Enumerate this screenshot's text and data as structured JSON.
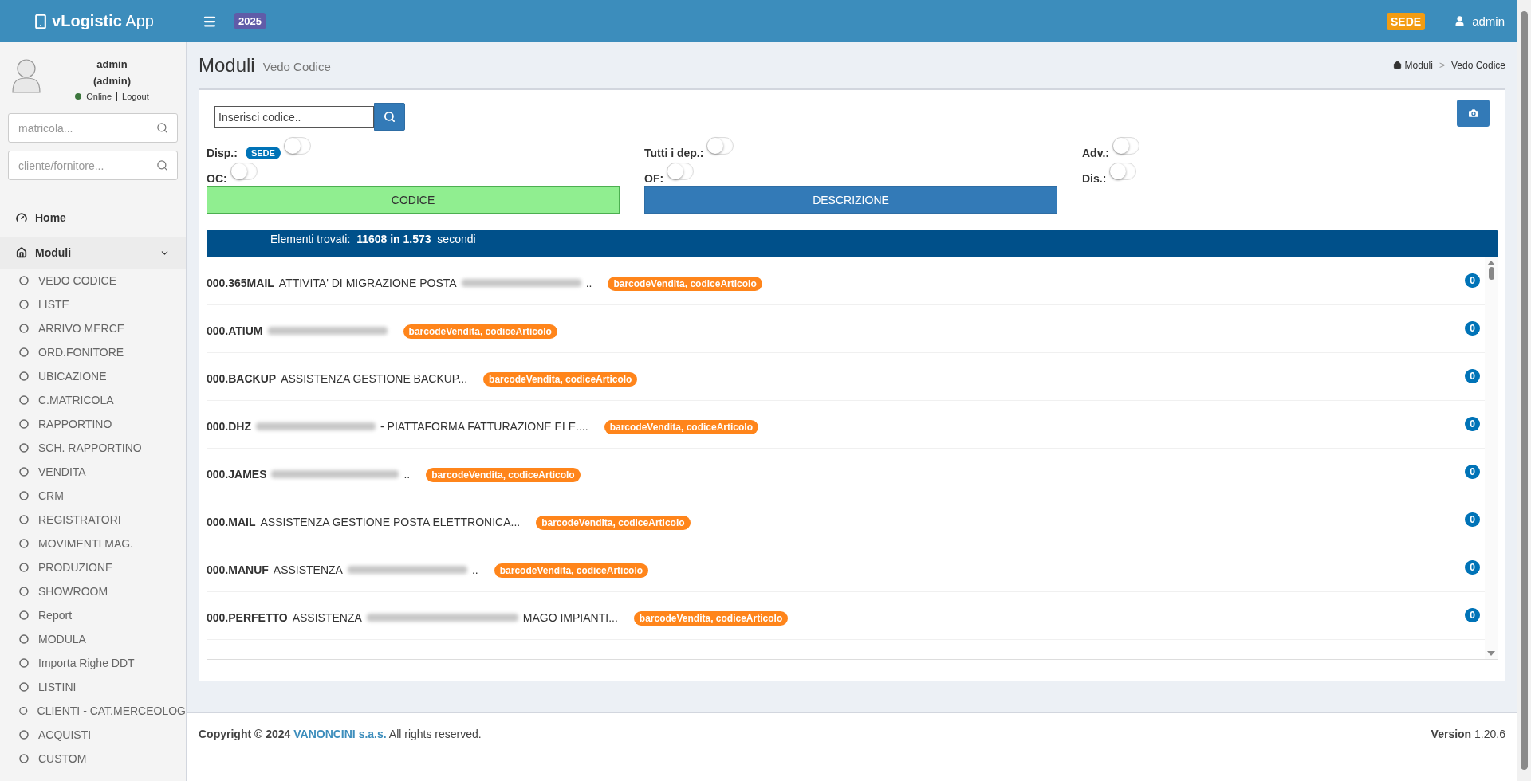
{
  "header": {
    "brand": "vLogistic App",
    "year": "2025",
    "branch": "SEDE",
    "user": "admin"
  },
  "sidebar": {
    "user": {
      "name": "admin",
      "role": "(admin)",
      "online": true,
      "status": "Online",
      "logout": "Logout"
    },
    "searches": [
      {
        "placeholder": "matricola..."
      },
      {
        "placeholder": "cliente/fornitore..."
      }
    ],
    "home": {
      "label": "Home"
    },
    "section": {
      "label": "Moduli",
      "expanded": true,
      "children": [
        {
          "label": "VEDO CODICE"
        },
        {
          "label": "LISTE"
        },
        {
          "label": "ARRIVO MERCE"
        },
        {
          "label": "ORD.FONITORE"
        },
        {
          "label": "UBICAZIONE"
        },
        {
          "label": "C.MATRICOLA"
        },
        {
          "label": "RAPPORTINO"
        },
        {
          "label": "SCH. RAPPORTINO"
        },
        {
          "label": "VENDITA"
        },
        {
          "label": "CRM"
        },
        {
          "label": "REGISTRATORI"
        },
        {
          "label": "MOVIMENTI MAG."
        },
        {
          "label": "PRODUZIONE"
        },
        {
          "label": "SHOWROOM"
        },
        {
          "label": "Report"
        },
        {
          "label": "MODULA"
        },
        {
          "label": "Importa Righe DDT"
        },
        {
          "label": "LISTINI"
        },
        {
          "label": "CLIENTI - CAT.MERCEOLOG"
        },
        {
          "label": "ACQUISTI"
        },
        {
          "label": "CUSTOM"
        }
      ]
    }
  },
  "page": {
    "title": "Moduli",
    "subtitle": "Vedo Codice",
    "breadcrumb": [
      "Moduli",
      "Vedo Codice"
    ],
    "breadcrumb_separator": ">"
  },
  "search": {
    "placeholder": "Inserisci codice.."
  },
  "toggles": [
    {
      "label": "Disp.:",
      "badge": "SEDE",
      "on": false
    },
    {
      "label": "Tutti i dep.:",
      "on": false
    },
    {
      "label": "Adv.:",
      "on": false
    },
    {
      "label": "OC:",
      "on": false
    },
    {
      "label": "OF:",
      "on": false
    },
    {
      "label": "Dis.:",
      "on": false
    }
  ],
  "modes": [
    {
      "label": "CODICE",
      "selected": true
    },
    {
      "label": "DESCRIZIONE",
      "selected": false
    }
  ],
  "results": {
    "summary": "Elementi trovati:  **11608 in 1.573**  secondi"
  },
  "rows": [
    {
      "code": "000.365MAIL",
      "description": [
        {
          "kind": "text",
          "text": "ATTIVITA' DI MIGRAZIONE POSTA"
        },
        {
          "kind": "blur"
        },
        {
          "kind": "text",
          "text": ".."
        }
      ],
      "tag": "barcodeVendita, codiceArticolo",
      "count": "0"
    },
    {
      "code": "000.ATIUM",
      "description": [
        {
          "kind": "blur"
        }
      ],
      "tag": "barcodeVendita, codiceArticolo",
      "count": "0"
    },
    {
      "code": "000.BACKUP",
      "description": [
        {
          "kind": "text",
          "text": "ASSISTENZA GESTIONE BACKUP..."
        }
      ],
      "tag": "barcodeVendita, codiceArticolo",
      "count": "0"
    },
    {
      "code": "000.DHZ",
      "description": [
        {
          "kind": "blur"
        },
        {
          "kind": "text",
          "text": "- PIATTAFORMA FATTURAZIONE ELE...."
        }
      ],
      "tag": "barcodeVendita, codiceArticolo",
      "count": "0"
    },
    {
      "code": "000.JAMES",
      "description": [
        {
          "kind": "blur"
        },
        {
          "kind": "text",
          "text": ".."
        }
      ],
      "tag": "barcodeVendita, codiceArticolo",
      "count": "0"
    },
    {
      "code": "000.MAIL",
      "description": [
        {
          "kind": "text",
          "text": "ASSISTENZA GESTIONE POSTA ELETTRONICA..."
        }
      ],
      "tag": "barcodeVendita, codiceArticolo",
      "count": "0"
    },
    {
      "code": "000.MANUF",
      "description": [
        {
          "kind": "text",
          "text": "ASSISTENZA"
        },
        {
          "kind": "blur"
        },
        {
          "kind": "text",
          "text": ".."
        }
      ],
      "tag": "barcodeVendita, codiceArticolo",
      "count": "0"
    },
    {
      "code": "000.PERFETTO",
      "description": [
        {
          "kind": "text",
          "text": "ASSISTENZA"
        },
        {
          "kind": "blur"
        },
        {
          "kind": "text",
          "text": "MAGO IMPIANTI..."
        }
      ],
      "tag": "barcodeVendita, codiceArticolo",
      "count": "0"
    }
  ],
  "footer": {
    "copyright": "Copyright © 2024",
    "company": "VANONCINI s.a.s.",
    "rights": "All rights reserved.",
    "version": "**Version** 1.20.6"
  }
}
